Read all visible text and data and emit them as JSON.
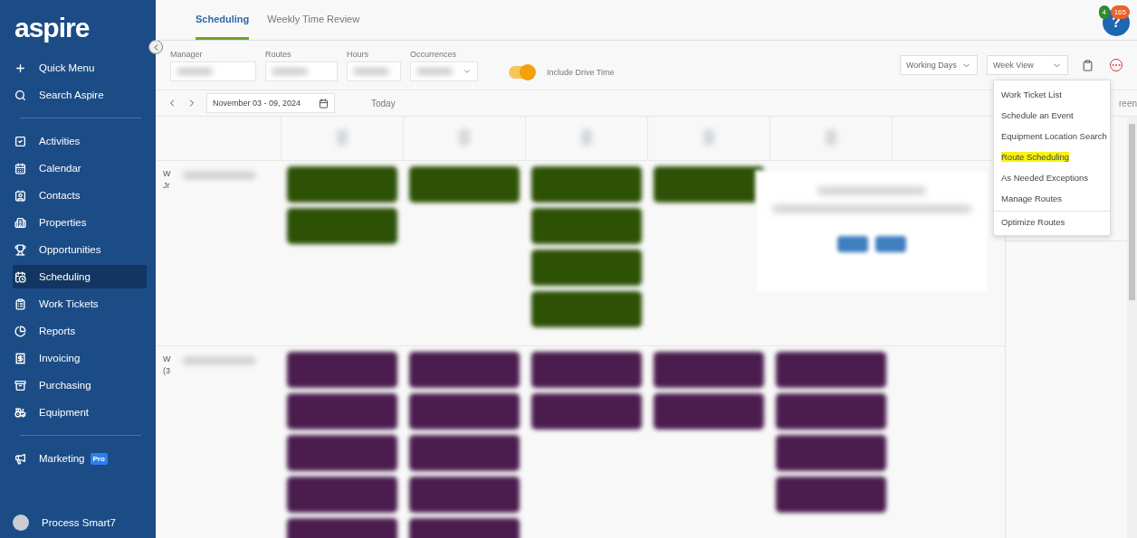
{
  "sidebar": {
    "logo": "aspire",
    "sections": [
      [
        {
          "label": "Quick Menu",
          "selected": false
        },
        {
          "label": "Search Aspire",
          "selected": false
        }
      ],
      [
        {
          "label": "Activities",
          "selected": false
        },
        {
          "label": "Calendar",
          "selected": false
        },
        {
          "label": "Contacts",
          "selected": false
        },
        {
          "label": "Properties",
          "selected": false
        },
        {
          "label": "Opportunities",
          "selected": false
        },
        {
          "label": "Scheduling",
          "selected": true
        },
        {
          "label": "Work Tickets",
          "selected": false
        },
        {
          "label": "Reports",
          "selected": false
        },
        {
          "label": "Invoicing",
          "selected": false
        },
        {
          "label": "Purchasing",
          "selected": false
        },
        {
          "label": "Equipment",
          "selected": false
        }
      ],
      [
        {
          "label": "Marketing",
          "selected": false,
          "badge": "Pro"
        }
      ]
    ],
    "user": "Process Smart7"
  },
  "tabs": [
    {
      "label": "Scheduling",
      "selected": true
    },
    {
      "label": "Weekly Time Review",
      "selected": false
    }
  ],
  "help": {
    "label": "?",
    "badges": [
      {
        "text": "4",
        "color": "#2e8b2e"
      },
      {
        "text": "165",
        "color": "#e8632a"
      }
    ]
  },
  "filters": [
    {
      "label": "Manager",
      "chevron": false
    },
    {
      "label": "Routes",
      "chevron": false
    },
    {
      "label": "Hours",
      "chevron": false
    },
    {
      "label": "Occurrences",
      "chevron": true
    }
  ],
  "drive_time": {
    "label": "Include Drive Time",
    "on": true
  },
  "view_selects": [
    "Working Days",
    "Week View"
  ],
  "date_bar": {
    "range": "November 03 -  09, 2024",
    "today": "Today",
    "right_fragment": "reen"
  },
  "rows": [
    {
      "fragments": [
        "W",
        "Jr"
      ],
      "color": "#2d5206",
      "days": [
        {
          "kind": "tickets",
          "tickets": [
            {
              "kind": "ticket"
            },
            {
              "kind": "ticket"
            }
          ]
        },
        {
          "kind": "tickets",
          "tickets": [
            {
              "kind": "ticket"
            }
          ]
        },
        {
          "kind": "tickets",
          "tickets": [
            {
              "kind": "ticket"
            },
            {
              "kind": "ticket"
            },
            {
              "kind": "ticket"
            },
            {
              "kind": "ticket"
            }
          ]
        },
        {
          "kind": "tickets",
          "tickets": [
            {
              "kind": "ticket"
            }
          ]
        },
        {
          "kind": "card"
        }
      ]
    },
    {
      "fragments": [
        "W",
        "(3"
      ],
      "color": "#4b1d4f",
      "days": [
        {
          "kind": "tickets",
          "tickets": [
            {
              "kind": "ticket"
            },
            {
              "kind": "ticket"
            },
            {
              "kind": "ticket"
            },
            {
              "kind": "ticket"
            },
            {
              "kind": "ticket"
            }
          ]
        },
        {
          "kind": "tickets",
          "tickets": [
            {
              "kind": "ticket"
            },
            {
              "kind": "ticket"
            },
            {
              "kind": "ticket"
            },
            {
              "kind": "ticket"
            },
            {
              "kind": "ticket"
            }
          ]
        },
        {
          "kind": "tickets",
          "tickets": [
            {
              "kind": "ticket"
            },
            {
              "kind": "ticket"
            }
          ]
        },
        {
          "kind": "tickets",
          "tickets": [
            {
              "kind": "ticket"
            },
            {
              "kind": "ticket"
            }
          ]
        },
        {
          "kind": "tickets",
          "tickets": [
            {
              "kind": "ticket"
            },
            {
              "kind": "ticket"
            },
            {
              "kind": "ticket"
            },
            {
              "kind": "ticket"
            }
          ]
        }
      ]
    }
  ],
  "menu": [
    {
      "label": "Work Ticket List",
      "highlighted": false,
      "separated": false
    },
    {
      "label": "Schedule an Event",
      "highlighted": false,
      "separated": false
    },
    {
      "label": "Equipment Location Search",
      "highlighted": false,
      "separated": false
    },
    {
      "label": "Route Scheduling",
      "highlighted": true,
      "separated": false
    },
    {
      "label": "As Needed Exceptions",
      "highlighted": false,
      "separated": false
    },
    {
      "label": "Manage Routes",
      "highlighted": false,
      "separated": false
    },
    {
      "label": "Optimize Routes",
      "highlighted": false,
      "separated": true
    }
  ]
}
